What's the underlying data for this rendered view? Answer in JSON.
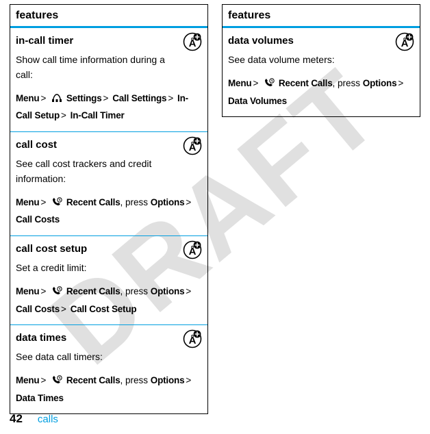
{
  "watermark": "DRAFT",
  "footer": {
    "page": "42",
    "section": "calls"
  },
  "left": {
    "header": "features",
    "cells": [
      {
        "title": "in-call timer",
        "desc": "Show call time information during a call:",
        "path": [
          {
            "t": "b",
            "v": "Menu"
          },
          {
            "t": "sep",
            "v": ">"
          },
          {
            "t": "icon",
            "v": "settings"
          },
          {
            "t": "b",
            "v": "Settings"
          },
          {
            "t": "sep",
            "v": ">"
          },
          {
            "t": "b",
            "v": "Call Settings"
          },
          {
            "t": "sep",
            "v": ">"
          },
          {
            "t": "b",
            "v": "In-Call Setup"
          },
          {
            "t": "sep",
            "v": ">"
          },
          {
            "t": "b",
            "v": "In-Call Timer"
          }
        ]
      },
      {
        "title": "call cost",
        "desc": "See call cost trackers and credit information:",
        "path": [
          {
            "t": "b",
            "v": "Menu"
          },
          {
            "t": "sep",
            "v": ">"
          },
          {
            "t": "icon",
            "v": "recent"
          },
          {
            "t": "b",
            "v": "Recent Calls"
          },
          {
            "t": "plain",
            "v": ", press "
          },
          {
            "t": "b",
            "v": "Options"
          },
          {
            "t": "sep",
            "v": ">"
          },
          {
            "t": "b",
            "v": "Call Costs"
          }
        ]
      },
      {
        "title": "call cost setup",
        "desc": "Set a credit limit:",
        "path": [
          {
            "t": "b",
            "v": "Menu"
          },
          {
            "t": "sep",
            "v": ">"
          },
          {
            "t": "icon",
            "v": "recent"
          },
          {
            "t": "b",
            "v": "Recent Calls"
          },
          {
            "t": "plain",
            "v": ", press "
          },
          {
            "t": "b",
            "v": "Options"
          },
          {
            "t": "sep",
            "v": ">"
          },
          {
            "t": "b",
            "v": "Call Costs"
          },
          {
            "t": "sep",
            "v": ">"
          },
          {
            "t": "b",
            "v": "Call Cost Setup"
          }
        ]
      },
      {
        "title": "data times",
        "desc": "See data call timers:",
        "path": [
          {
            "t": "b",
            "v": "Menu"
          },
          {
            "t": "sep",
            "v": ">"
          },
          {
            "t": "icon",
            "v": "recent"
          },
          {
            "t": "b",
            "v": "Recent Calls"
          },
          {
            "t": "plain",
            "v": ", press "
          },
          {
            "t": "b",
            "v": "Options"
          },
          {
            "t": "sep",
            "v": ">"
          },
          {
            "t": "b",
            "v": "Data Times"
          }
        ]
      }
    ]
  },
  "right": {
    "header": "features",
    "cells": [
      {
        "title": "data volumes",
        "desc": "See data volume meters:",
        "path": [
          {
            "t": "b",
            "v": "Menu"
          },
          {
            "t": "sep",
            "v": ">"
          },
          {
            "t": "icon",
            "v": "recent"
          },
          {
            "t": "b",
            "v": "Recent Calls"
          },
          {
            "t": "plain",
            "v": ", press "
          },
          {
            "t": "b",
            "v": "Options"
          },
          {
            "t": "sep",
            "v": ">"
          },
          {
            "t": "b",
            "v": "Data Volumes"
          }
        ]
      }
    ]
  }
}
